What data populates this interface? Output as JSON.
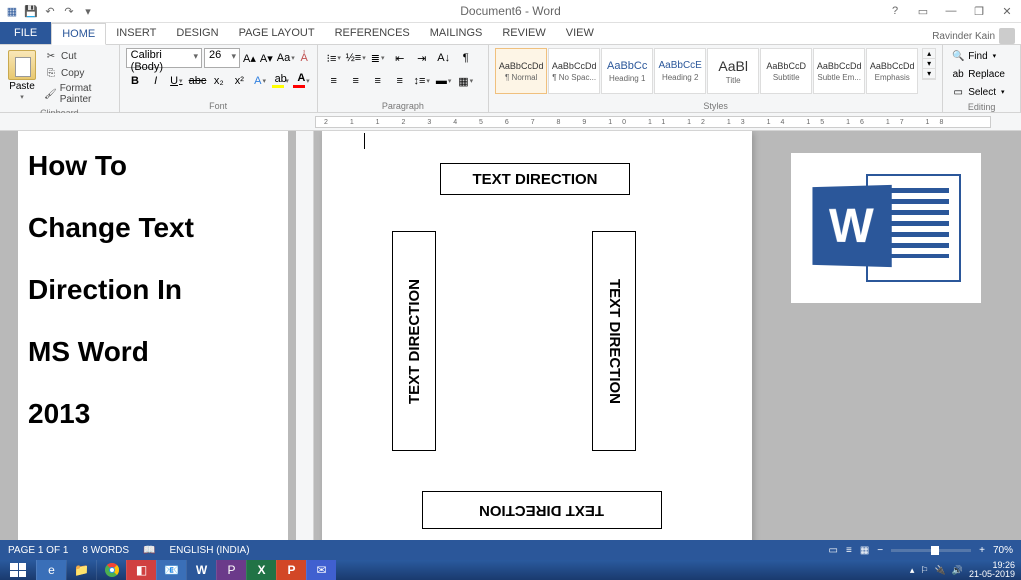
{
  "titlebar": {
    "doc_title": "Document6 - Word"
  },
  "tabs": {
    "file": "FILE",
    "home": "HOME",
    "insert": "INSERT",
    "design": "DESIGN",
    "page_layout": "PAGE LAYOUT",
    "references": "REFERENCES",
    "mailings": "MAILINGS",
    "review": "REVIEW",
    "view": "VIEW"
  },
  "user": {
    "name": "Ravinder Kain"
  },
  "clipboard": {
    "group": "Clipboard",
    "paste": "Paste",
    "cut": "Cut",
    "copy": "Copy",
    "format_painter": "Format Painter"
  },
  "font": {
    "group": "Font",
    "name": "Calibri (Body)",
    "size": "26"
  },
  "paragraph": {
    "group": "Paragraph"
  },
  "styles": {
    "group": "Styles",
    "items": [
      {
        "preview": "AaBbCcDd",
        "name": "¶ Normal",
        "cls": ""
      },
      {
        "preview": "AaBbCcDd",
        "name": "¶ No Spac...",
        "cls": ""
      },
      {
        "preview": "AaBbCc",
        "name": "Heading 1",
        "cls": "h1"
      },
      {
        "preview": "AaBbCcE",
        "name": "Heading 2",
        "cls": "h2"
      },
      {
        "preview": "AaBl",
        "name": "Title",
        "cls": "title"
      },
      {
        "preview": "AaBbCcD",
        "name": "Subtitle",
        "cls": ""
      },
      {
        "preview": "AaBbCcDd",
        "name": "Subtle Em...",
        "cls": ""
      },
      {
        "preview": "AaBbCcDd",
        "name": "Emphasis",
        "cls": ""
      }
    ]
  },
  "editing": {
    "group": "Editing",
    "find": "Find",
    "replace": "Replace",
    "select": "Select"
  },
  "ruler_marks": "2  1    1  2  3  4  5  6  7  8  9  10 11 12 13 14 15 16 17 18",
  "tutorial": {
    "l1": "How To",
    "l2": "Change Text",
    "l3": "Direction In",
    "l4": "MS Word",
    "l5": "2013"
  },
  "textboxes": {
    "t1": "TEXT DIRECTION",
    "t2": "TEXT DIRECTION",
    "t3": "TEXT DIRECTION",
    "t4": "TEXT DIRECTION"
  },
  "word_badge": "W",
  "status": {
    "page": "PAGE 1 OF 1",
    "words": "8 WORDS",
    "lang": "ENGLISH (INDIA)",
    "zoom": "70%"
  },
  "tray": {
    "time": "19:26",
    "date": "21-05-2019"
  }
}
